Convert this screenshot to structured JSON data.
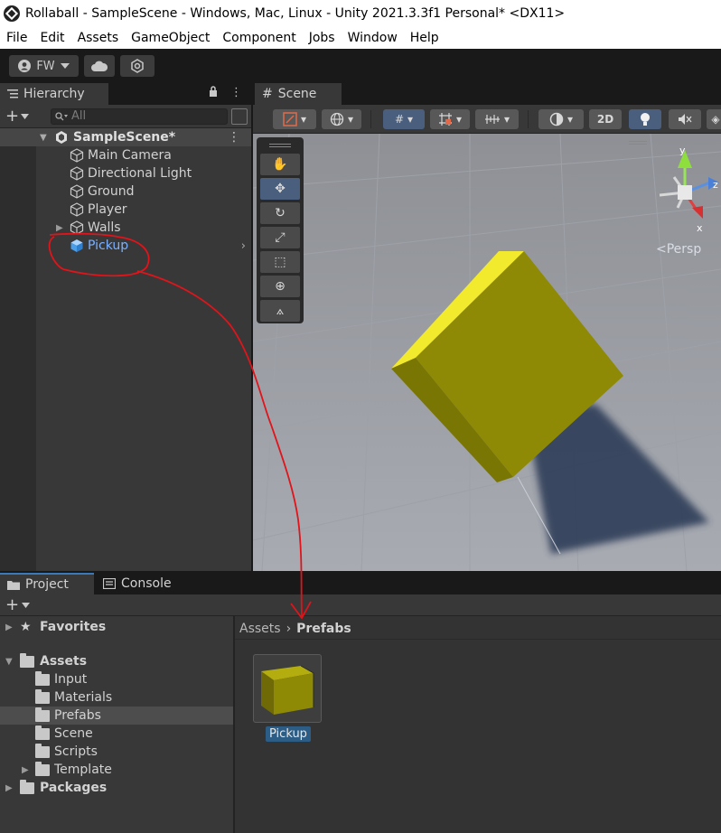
{
  "window": {
    "title": "Rollaball - SampleScene - Windows, Mac, Linux - Unity 2021.3.3f1 Personal* <DX11>"
  },
  "menu": [
    "File",
    "Edit",
    "Assets",
    "GameObject",
    "Component",
    "Jobs",
    "Window",
    "Help"
  ],
  "toolbar": {
    "account": "FW"
  },
  "hierarchy": {
    "tab_label": "Hierarchy",
    "search_placeholder": "All",
    "scene_name": "SampleScene*",
    "items": [
      {
        "label": "Main Camera"
      },
      {
        "label": "Directional Light"
      },
      {
        "label": "Ground"
      },
      {
        "label": "Player"
      },
      {
        "label": "Walls"
      },
      {
        "label": "Pickup"
      }
    ]
  },
  "scene": {
    "tab_label": "Scene",
    "mode_2d": "2D",
    "gizmo": {
      "y": "y",
      "z": "z",
      "x": "x",
      "projection": "<Persp"
    }
  },
  "bottom": {
    "tabs": [
      {
        "label": "Project"
      },
      {
        "label": "Console"
      }
    ],
    "tree": [
      {
        "label": "Favorites"
      },
      {
        "label": "Assets"
      },
      {
        "label": "Input"
      },
      {
        "label": "Materials"
      },
      {
        "label": "Prefabs"
      },
      {
        "label": "Scene"
      },
      {
        "label": "Scripts"
      },
      {
        "label": "Template"
      },
      {
        "label": "Packages"
      }
    ],
    "breadcrumb": {
      "root": "Assets",
      "current": "Prefabs"
    },
    "asset": {
      "label": "Pickup"
    }
  },
  "colors": {
    "accent": "#4a5f7d",
    "prefab_text": "#7cb0ff",
    "annotation": "#e0141a",
    "cube": "#8f8a05"
  }
}
